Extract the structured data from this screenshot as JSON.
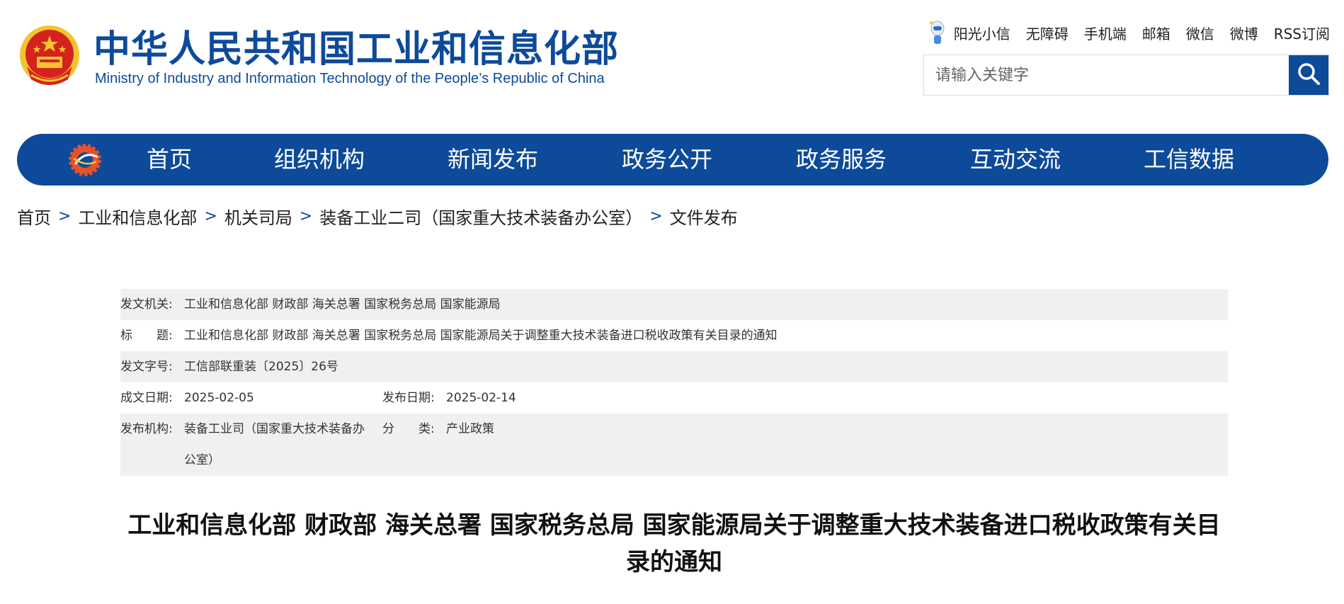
{
  "header": {
    "title": "中华人民共和国工业和信息化部",
    "subtitle": "Ministry of Industry and Information Technology of the People’s Republic of China",
    "links": [
      "阳光小信",
      "无障碍",
      "手机端",
      "邮箱",
      "微信",
      "微博",
      "RSS订阅"
    ],
    "search_placeholder": "请输入关键字"
  },
  "nav": {
    "items": [
      "首页",
      "组织机构",
      "新闻发布",
      "政务公开",
      "政务服务",
      "互动交流",
      "工信数据"
    ]
  },
  "breadcrumb": [
    "首页",
    "工业和信息化部",
    "机关司局",
    "装备工业二司（国家重大技术装备办公室）",
    "文件发布"
  ],
  "breadcrumb_separator": ">",
  "meta": {
    "issuer_label": "发文机关:",
    "issuer": "工业和信息化部 财政部 海关总署 国家税务总局 国家能源局",
    "title_label": "标　　题:",
    "title": "工业和信息化部 财政部 海关总署 国家税务总局 国家能源局关于调整重大技术装备进口税收政策有关目录的通知",
    "doc_no_label": "发文字号:",
    "doc_no": "工信部联重装〔2025〕26号",
    "created_label": "成文日期:",
    "created": "2025-02-05",
    "published_label": "发布日期:",
    "published": "2025-02-14",
    "org_label": "发布机构:",
    "org": "装备工业司（国家重大技术装备办公室）",
    "category_label": "分　　类:",
    "category": "产业政策"
  },
  "doc_title": "工业和信息化部 财政部 海关总署 国家税务总局 国家能源局关于调整重大技术装备进口税收政策有关目录的通知",
  "colors": {
    "brand": "#0d4a9a",
    "shade": "#f0f0f0",
    "emblem_red": "#d4231c",
    "emblem_gold": "#f4c430"
  },
  "icons": [
    "national-emblem-icon",
    "mascot-icon",
    "search-icon",
    "gear-emblem-icon"
  ]
}
